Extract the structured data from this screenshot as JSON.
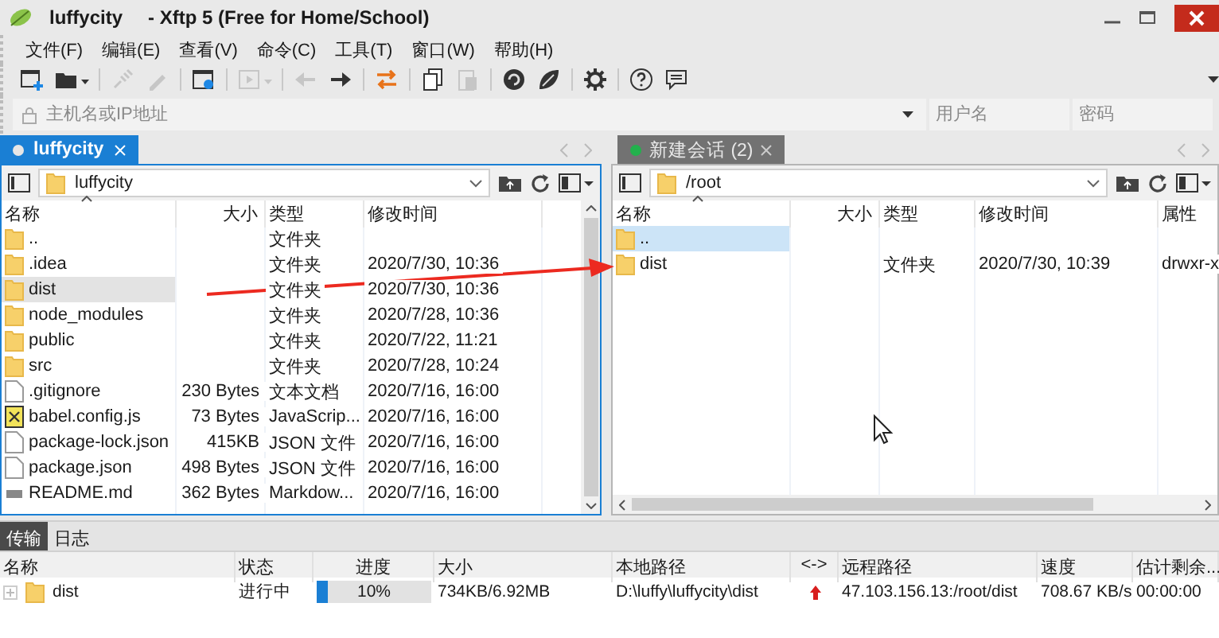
{
  "window": {
    "session": "luffycity",
    "title": "- Xftp 5 (Free for Home/School)"
  },
  "menu": [
    "文件(F)",
    "编辑(E)",
    "查看(V)",
    "命令(C)",
    "工具(T)",
    "窗口(W)",
    "帮助(H)"
  ],
  "toolbar": [
    [
      {
        "disabled": false
      },
      {
        "disabled": false
      }
    ],
    [
      {
        "disabled": true
      },
      {
        "disabled": true
      }
    ],
    [
      {
        "disabled": false
      }
    ],
    [
      {
        "disabled": true
      }
    ],
    [
      {
        "disabled": true
      },
      {
        "disabled": false
      }
    ],
    [
      {
        "disabled": false
      }
    ],
    [
      {
        "disabled": false
      },
      {
        "disabled": true
      }
    ],
    [
      {
        "disabled": false
      },
      {
        "disabled": false
      }
    ],
    [
      {
        "disabled": false
      }
    ],
    [
      {
        "disabled": false
      },
      {
        "disabled": false
      }
    ]
  ],
  "address": {
    "host": {
      "placeholder": "主机名或IP地址"
    },
    "username": {
      "placeholder": "用户名"
    },
    "password": {
      "placeholder": "密码"
    }
  },
  "panels": [
    {
      "tab": {
        "label": "luffycity",
        "selected": true,
        "color": "#e6e6e6"
      },
      "path": "luffycity",
      "columns": [
        "名称",
        "大小",
        "类型",
        "修改时间"
      ],
      "rows": [
        {
          "name": "..",
          "type": "文件夹",
          "kind": "folder",
          "selected": false
        },
        {
          "name": ".idea",
          "type": "文件夹",
          "modified": "2020/7/30, 10:36",
          "kind": "folder",
          "selected": false
        },
        {
          "name": "dist",
          "type": "文件夹",
          "modified": "2020/7/30, 10:36",
          "kind": "folder",
          "selected": true
        },
        {
          "name": "node_modules",
          "type": "文件夹",
          "modified": "2020/7/28, 10:36",
          "kind": "folder",
          "selected": false
        },
        {
          "name": "public",
          "type": "文件夹",
          "modified": "2020/7/22, 11:21",
          "kind": "folder",
          "selected": false
        },
        {
          "name": "src",
          "type": "文件夹",
          "modified": "2020/7/28, 10:24",
          "kind": "folder",
          "selected": false
        },
        {
          "name": ".gitignore",
          "size": "230 Bytes",
          "type": "文本文档",
          "modified": "2020/7/16, 16:00",
          "kind": "text",
          "selected": false
        },
        {
          "name": "babel.config.js",
          "size": "73 Bytes",
          "type": "JavaScrip...",
          "modified": "2020/7/16, 16:00",
          "kind": "js",
          "selected": false
        },
        {
          "name": "package-lock.json",
          "size": "415KB",
          "type": "JSON 文件",
          "modified": "2020/7/16, 16:00",
          "kind": "json",
          "selected": false
        },
        {
          "name": "package.json",
          "size": "498 Bytes",
          "type": "JSON 文件",
          "modified": "2020/7/16, 16:00",
          "kind": "json",
          "selected": false
        },
        {
          "name": "README.md",
          "size": "362 Bytes",
          "type": "Markdow...",
          "modified": "2020/7/16, 16:00",
          "kind": "markdown",
          "selected": false
        }
      ]
    },
    {
      "tab": {
        "label": "新建会话 (2)",
        "selected": false,
        "color": "#22b14c"
      },
      "path": "/root",
      "columns": [
        "名称",
        "大小",
        "类型",
        "修改时间",
        "属性"
      ],
      "rows": [
        {
          "name": "..",
          "kind": "folder",
          "selected": true
        },
        {
          "name": "dist",
          "type": "文件夹",
          "modified": "2020/7/30, 10:39",
          "attributes": "drwxr-x",
          "kind": "folder",
          "selected": false
        }
      ]
    }
  ],
  "transfers": {
    "tabs": [
      {
        "label": "传输",
        "selected": true
      },
      {
        "label": "日志",
        "selected": false
      }
    ],
    "columns": [
      "名称",
      "状态",
      "进度",
      "大小",
      "本地路径",
      "<->",
      "远程路径",
      "速度",
      "估计剩余..."
    ],
    "rows": [
      {
        "name": "dist",
        "status": "进行中",
        "level": 0.1,
        "progress": "10%",
        "size": "734KB/6.92MB",
        "local": "D:\\luffy\\luffycity\\dist",
        "kind": "upload",
        "remote": "47.103.156.13:/root/dist",
        "speed": "708.67 KB/s",
        "remaining": "00:00:00"
      }
    ]
  }
}
